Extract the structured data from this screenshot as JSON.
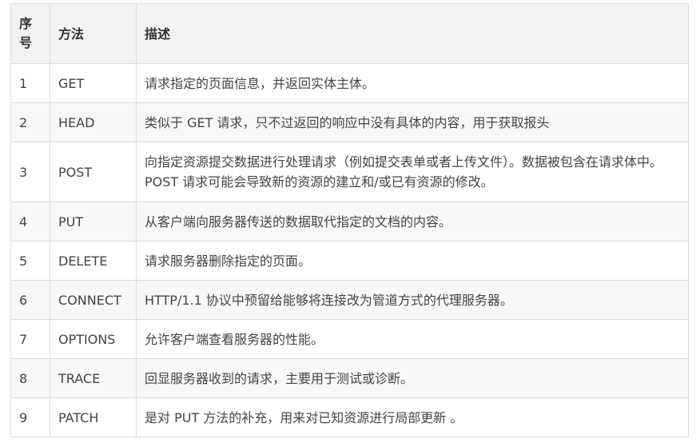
{
  "table": {
    "headers": {
      "number": "序号",
      "method": "方法",
      "description": "描述"
    },
    "rows": [
      {
        "number": "1",
        "method": "GET",
        "description": "请求指定的页面信息，并返回实体主体。"
      },
      {
        "number": "2",
        "method": "HEAD",
        "description": "类似于 GET 请求，只不过返回的响应中没有具体的内容，用于获取报头"
      },
      {
        "number": "3",
        "method": "POST",
        "description": "向指定资源提交数据进行处理请求（例如提交表单或者上传文件）。数据被包含在请求体中。POST 请求可能会导致新的资源的建立和/或已有资源的修改。"
      },
      {
        "number": "4",
        "method": "PUT",
        "description": "从客户端向服务器传送的数据取代指定的文档的内容。"
      },
      {
        "number": "5",
        "method": "DELETE",
        "description": "请求服务器删除指定的页面。"
      },
      {
        "number": "6",
        "method": "CONNECT",
        "description": "HTTP/1.1 协议中预留给能够将连接改为管道方式的代理服务器。"
      },
      {
        "number": "7",
        "method": "OPTIONS",
        "description": "允许客户端查看服务器的性能。"
      },
      {
        "number": "8",
        "method": "TRACE",
        "description": "回显服务器收到的请求，主要用于测试或诊断。"
      },
      {
        "number": "9",
        "method": "PATCH",
        "description": "是对 PUT 方法的补充，用来对已知资源进行局部更新 。"
      }
    ]
  }
}
